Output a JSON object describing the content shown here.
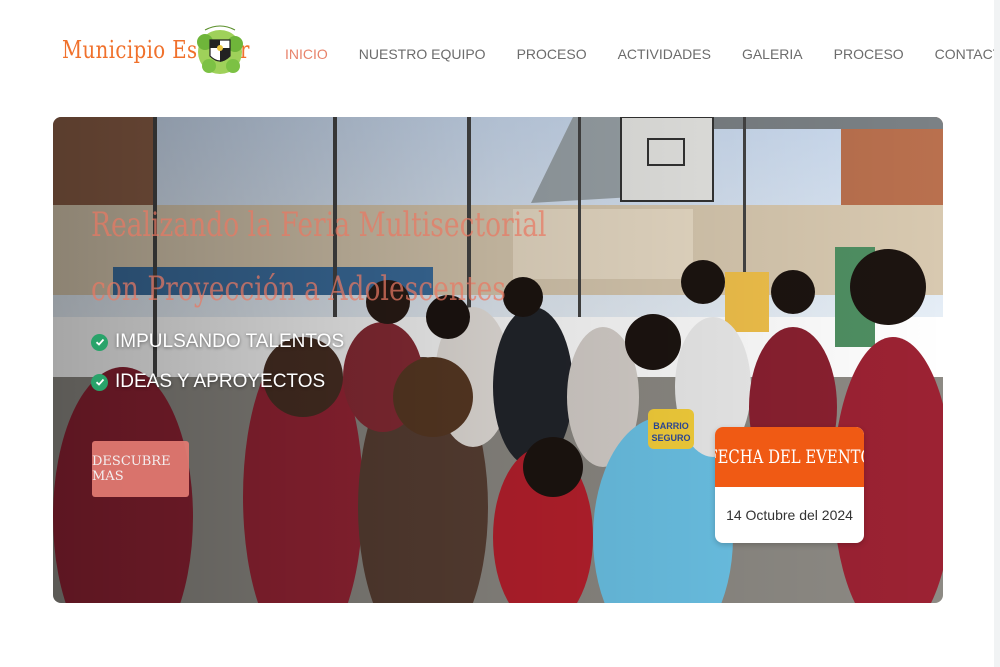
{
  "brand": {
    "name": "Municipio Escolar",
    "emblem_icon": "school-shield-emblem"
  },
  "nav": {
    "items": [
      {
        "label": "INICIO",
        "active": true
      },
      {
        "label": "NUESTRO EQUIPO",
        "active": false
      },
      {
        "label": "PROCESO",
        "active": false
      },
      {
        "label": "ACTIVIDADES",
        "active": false
      },
      {
        "label": "GALERIA",
        "active": false
      },
      {
        "label": "PROCESO",
        "active": false
      },
      {
        "label": "CONTACTANOS",
        "active": false
      }
    ]
  },
  "hero": {
    "title_line1": "Realizando la Feria Multisectorial",
    "title_line2": "con Proyección a Adolescentes",
    "bullets": [
      "IMPULSANDO TALENTOS",
      "IDEAS Y APROYECTOS"
    ],
    "bullet_icon": "check-circle-icon",
    "cta_label": "DESCUBRE MAS",
    "vest_text": "BARRIO SEGURO"
  },
  "event": {
    "heading": "FECHA DEL EVENTO",
    "date": "14 Octubre del 2024"
  },
  "colors": {
    "accent_orange": "#f05a14",
    "logo_orange": "#f0712c",
    "nav_active": "#e8836b",
    "cta_bg": "#e27a72",
    "check_green": "#29a36a"
  }
}
